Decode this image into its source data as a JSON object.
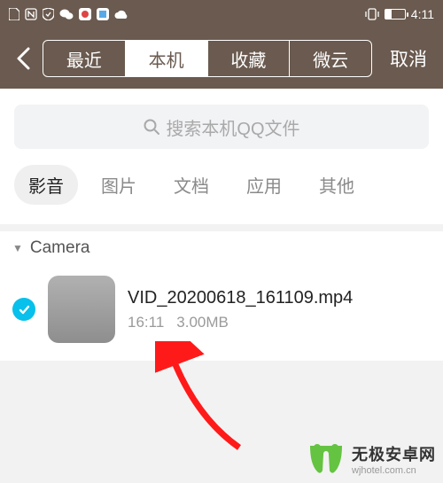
{
  "status": {
    "time": "4:11"
  },
  "header": {
    "segments": [
      "最近",
      "本机",
      "收藏",
      "微云"
    ],
    "active_segment": "本机",
    "cancel": "取消"
  },
  "search": {
    "placeholder": "搜索本机QQ文件"
  },
  "tabs": {
    "items": [
      "影音",
      "图片",
      "文档",
      "应用",
      "其他"
    ],
    "active": "影音"
  },
  "group": {
    "name": "Camera"
  },
  "file": {
    "name": "VID_20200618_161109.mp4",
    "time": "16:11",
    "size": "3.00MB",
    "checked": true
  },
  "watermark": {
    "title": "无极安卓网",
    "sub": "wjhotel.com.cn"
  }
}
